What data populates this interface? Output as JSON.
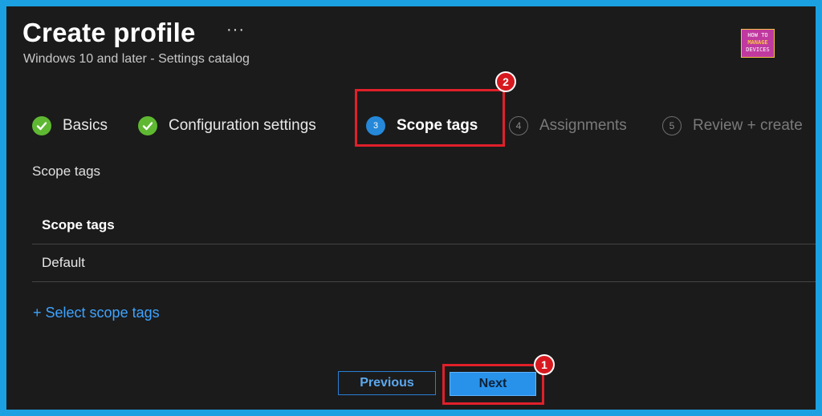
{
  "header": {
    "title": "Create profile",
    "more_glyph": "···",
    "subtitle": "Windows 10 and later - Settings catalog"
  },
  "logo": {
    "line1": "HOW TO",
    "line2": "MANAGE",
    "line3": "DEVICES"
  },
  "steps": [
    {
      "label": "Basics",
      "state": "complete"
    },
    {
      "label": "Configuration settings",
      "state": "complete"
    },
    {
      "number": "3",
      "label": "Scope tags",
      "state": "active"
    },
    {
      "number": "4",
      "label": "Assignments",
      "state": "pending"
    },
    {
      "number": "5",
      "label": "Review + create",
      "state": "pending"
    }
  ],
  "annotations": {
    "badge_scope_tags": "2",
    "badge_next": "1"
  },
  "scope_section": {
    "heading": "Scope tags",
    "table_header": "Scope tags",
    "rows": [
      "Default"
    ],
    "select_link": "+ Select scope tags"
  },
  "footer": {
    "previous_label": "Previous",
    "next_label": "Next"
  },
  "colors": {
    "accent": "#2892ea",
    "complete": "#5fb832",
    "highlight": "#e0202a",
    "border": "#1ba1e2"
  }
}
